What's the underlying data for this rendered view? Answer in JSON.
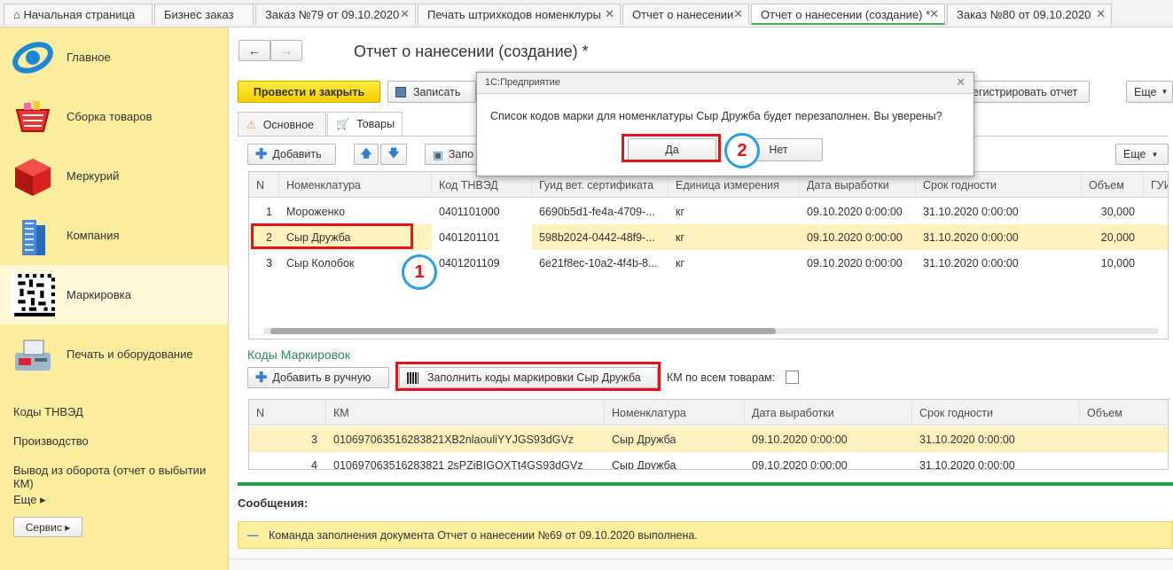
{
  "tabs": [
    {
      "label": "Начальная страница",
      "home": true
    },
    {
      "label": "Бизнес заказ"
    },
    {
      "label": "Заказ №79 от 09.10.2020"
    },
    {
      "label": "Печать штрихкодов номенклуры"
    },
    {
      "label": "Отчет о нанесении"
    },
    {
      "label": "Отчет о нанесении (создание) *"
    },
    {
      "label": "Заказ №80 от 09.10.2020"
    }
  ],
  "sidebar": {
    "sections": [
      {
        "label": "Главное"
      },
      {
        "label": "Сборка товаров"
      },
      {
        "label": "Меркурий"
      },
      {
        "label": "Компания"
      },
      {
        "label": "Маркировка"
      },
      {
        "label": "Печать и оборудование"
      }
    ],
    "links": [
      "Коды ТНВЭД",
      "Производство",
      "Вывод из оборота (отчет о выбытии КМ)",
      "Еще ▸"
    ],
    "service_button": "Сервис ▸"
  },
  "form": {
    "title": "Отчет о нанесении (создание) *",
    "post_close": "Провести и закрыть",
    "save": "Записать",
    "register": "егистрировать отчет",
    "more": "Еще",
    "tab_main": "Основное",
    "tab_goods": "Товары",
    "add": "Добавить",
    "fill": "Запо",
    "more2": "Еще"
  },
  "goods_table": {
    "columns": [
      "N",
      "Номенклатура",
      "Код ТНВЭД",
      "Гуид вет. сертификата",
      "Единица измерения",
      "Дата выработки",
      "Срок годности",
      "Объем",
      "ГУИ"
    ],
    "rows": [
      [
        "1",
        "Мороженко",
        "0401101000",
        "6690b5d1-fe4a-4709-...",
        "кг",
        "09.10.2020 0:00:00",
        "31.10.2020 0:00:00",
        "30,000"
      ],
      [
        "2",
        "Сыр Дружба",
        "0401201101",
        "598b2024-0442-48f9-...",
        "кг",
        "09.10.2020 0:00:00",
        "31.10.2020 0:00:00",
        "20,000"
      ],
      [
        "3",
        "Сыр Колобок",
        "0401201109",
        "6e21f8ec-10a2-4f4b-8...",
        "кг",
        "09.10.2020 0:00:00",
        "31.10.2020 0:00:00",
        "10,000"
      ]
    ]
  },
  "codes": {
    "section_title": "Коды Маркировок",
    "add_manual": "Добавить в ручную",
    "fill_codes": "Заполнить коды маркировки Сыр Дружба",
    "km_all": "КМ по всем товарам:",
    "columns": [
      "N",
      "КМ",
      "Номенклатура",
      "Дата выработки",
      "Срок годности",
      "Объем"
    ],
    "rows": [
      [
        "3",
        "010697063516283821XB2nlaouliYYJGS93dGVz",
        "Сыр Дружба",
        "09.10.2020 0:00:00",
        "31.10.2020 0:00:00",
        ""
      ],
      [
        "4",
        "010697063516283821 2sPZiBIGOXTt4GS93dGVz",
        "Сыр Дружба",
        "09.10.2020 0:00:00",
        "31.10.2020 0:00:00",
        ""
      ]
    ]
  },
  "messages": {
    "title": "Сообщения:",
    "text": "Команда заполнения документа Отчет о нанесении №69 от 09.10.2020 выполнена."
  },
  "dialog": {
    "title": "1С:Предприятие",
    "message": "Список кодов марки для номенклатуры Сыр Дружба будет перезаполнен. Вы уверены?",
    "yes": "Да",
    "no": "Нет"
  },
  "badges": {
    "one": "1",
    "two": "2"
  }
}
